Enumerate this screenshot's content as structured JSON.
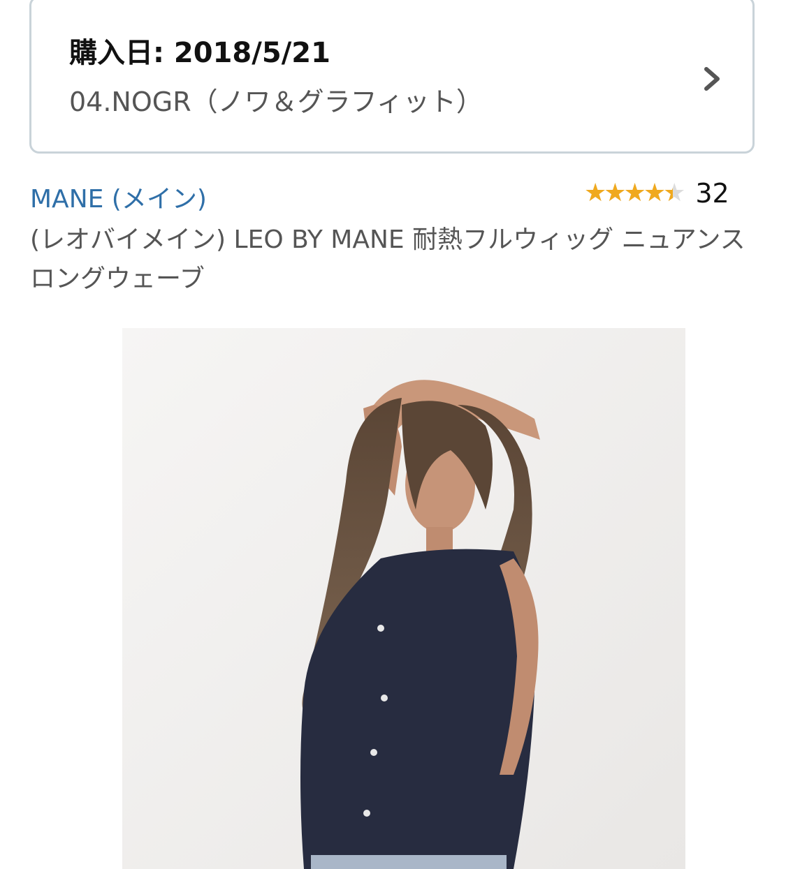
{
  "order": {
    "purchase_date_label": "購入日: 2018/5/21",
    "variant": "04.NOGR（ノワ＆グラフィット）"
  },
  "product": {
    "brand": "MANE (メイン)",
    "title": "(レオバイメイン) LEO BY MANE 耐熱フルウィッグ ニュアンスロングウェーブ",
    "rating_stars": 4.5,
    "rating_max": 5,
    "review_count": "32",
    "image_alt": "product-photo"
  },
  "colors": {
    "link": "#2f6fa8",
    "star_fill": "#f0a91e",
    "star_empty": "#dcdcdc",
    "card_border": "#c9d3d9"
  }
}
